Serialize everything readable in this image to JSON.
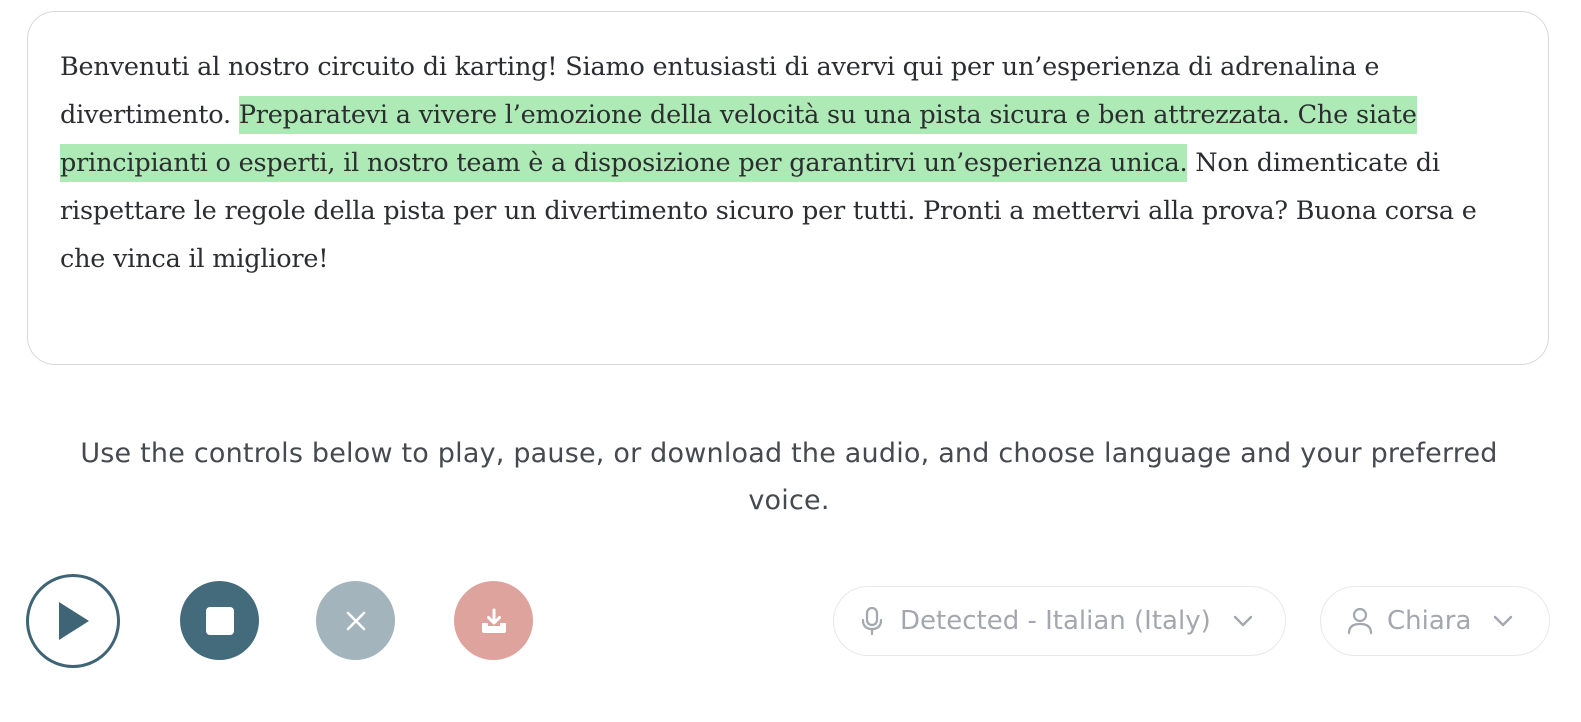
{
  "passage": {
    "before": "Benvenuti al nostro circuito di karting! Siamo entusiasti di avervi qui per un’esperienza di adrenalina e divertimento. ",
    "highlighted": "Preparatevi a vivere l’emozione della velocità su una pista sicura e ben attrezzata. Che siate principianti o esperti, il nostro team è a disposizione per garantirvi un’esperienza unica.",
    "after": " Non dimenticate di rispettare le regole della pista per un divertimento sicuro per tutti. Pronti a mettervi alla prova? Buona corsa e che vinca il migliore!"
  },
  "instructions": "Use the controls below to play, pause, or download the audio, and choose language and your preferred voice.",
  "controls": {
    "play": {
      "icon": "play-icon"
    },
    "stop": {
      "icon": "stop-icon"
    },
    "clear": {
      "icon": "close-icon"
    },
    "download": {
      "icon": "download-icon"
    }
  },
  "language_select": {
    "icon": "microphone-icon",
    "selected": "Detected - Italian (Italy)"
  },
  "voice_select": {
    "icon": "user-icon",
    "selected": "Chiara"
  },
  "colors": {
    "highlight": "#aeeab5",
    "primary": "#436b7c",
    "muted": "#a3b4bc",
    "download": "#dea39d"
  }
}
